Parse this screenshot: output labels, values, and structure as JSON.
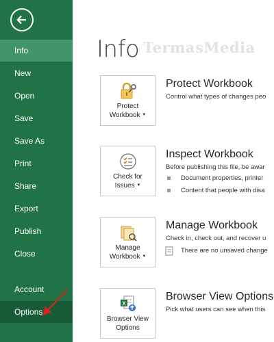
{
  "sidebar": {
    "back_icon": "back-arrow-icon",
    "items": [
      {
        "label": "Info",
        "state": "selected"
      },
      {
        "label": "New"
      },
      {
        "label": "Open"
      },
      {
        "label": "Save"
      },
      {
        "label": "Save As"
      },
      {
        "label": "Print"
      },
      {
        "label": "Share"
      },
      {
        "label": "Export"
      },
      {
        "label": "Publish"
      },
      {
        "label": "Close"
      },
      {
        "label": "Account"
      },
      {
        "label": "Options",
        "state": "hover"
      }
    ]
  },
  "main": {
    "title": "Info",
    "watermark": "TermasMedia",
    "sections": [
      {
        "button_line1": "Protect",
        "button_line2": "Workbook",
        "button_icon": "lock-key-icon",
        "title": "Protect Workbook",
        "text": "Control what types of changes peo"
      },
      {
        "button_line1": "Check for",
        "button_line2": "Issues",
        "button_icon": "checklist-icon",
        "title": "Inspect Workbook",
        "text": "Before publishing this file, be awar",
        "bullets": [
          "Document properties, printer",
          "Content that people with disa"
        ]
      },
      {
        "button_line1": "Manage",
        "button_line2": "Workbook",
        "button_icon": "manage-documents-icon",
        "title": "Manage Workbook",
        "text": "Check in, check out, and recover u",
        "sub_text": "There are no unsaved change"
      },
      {
        "button_line1": "Browser View",
        "button_line2": "Options",
        "button_icon": "excel-browser-icon",
        "title": "Browser View Options",
        "text": "Pick what users can see when this"
      }
    ]
  },
  "colors": {
    "sidebar": "#217346",
    "selected": "#439467",
    "hover": "#185c37",
    "annotation_arrow": "#e02020"
  }
}
